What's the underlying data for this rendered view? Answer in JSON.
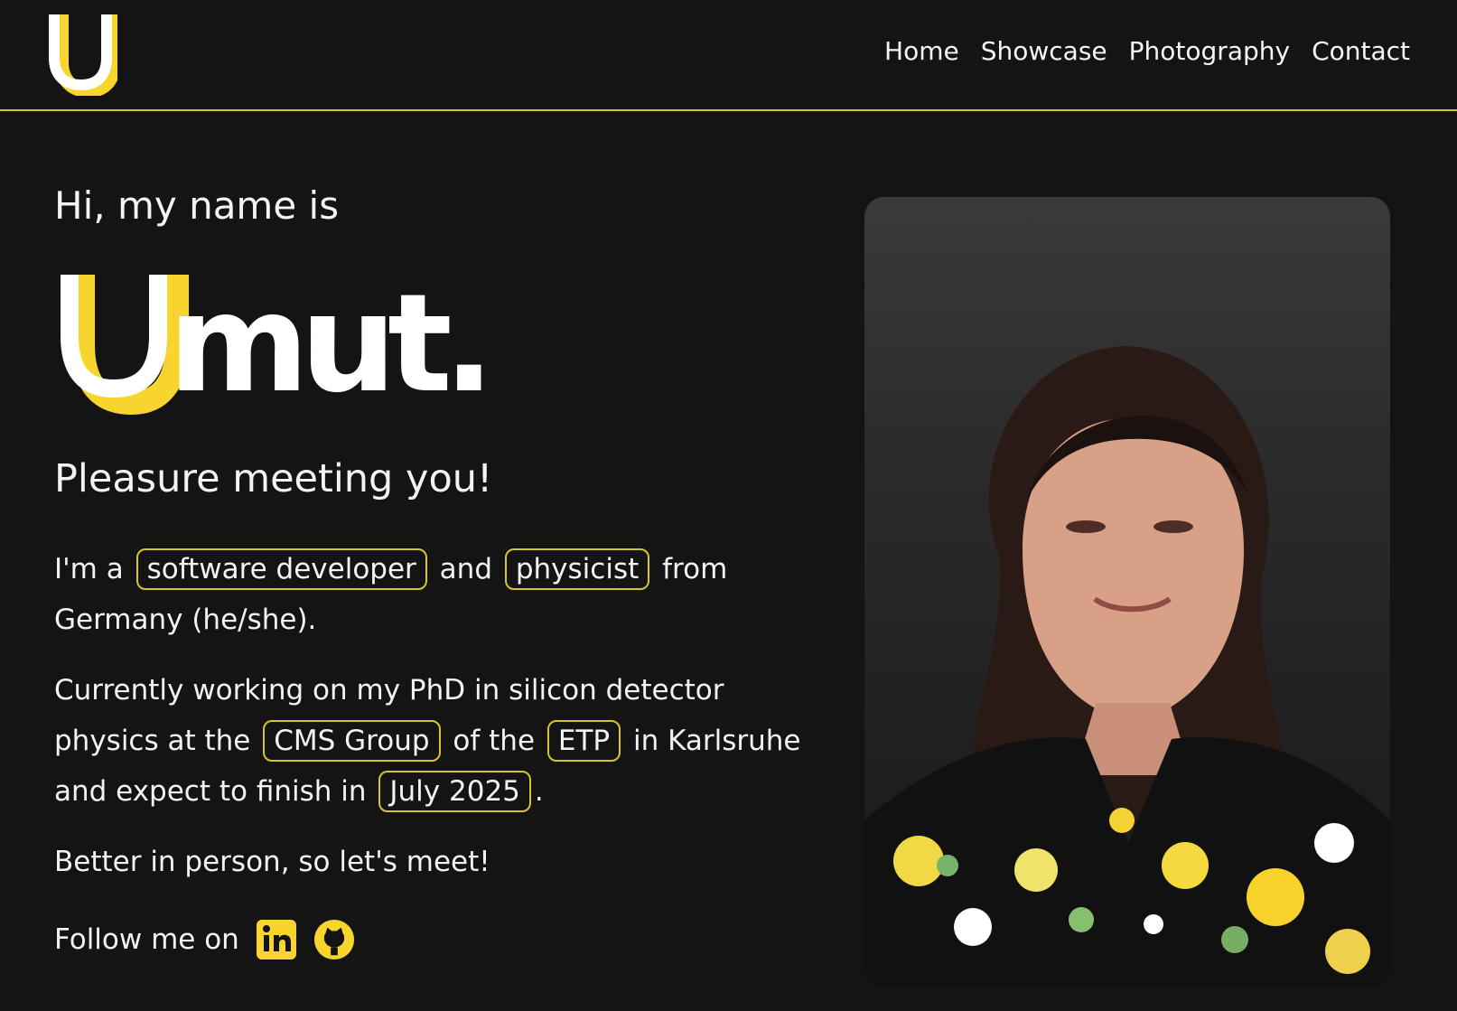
{
  "nav": {
    "items": [
      "Home",
      "Showcase",
      "Photography",
      "Contact"
    ]
  },
  "hero": {
    "greeting": "Hi, my name is",
    "name_main": "mut.",
    "subtitle": "Pleasure meeting you!",
    "intro": {
      "part1": "I'm a",
      "tag1": "software developer",
      "part2": "and",
      "tag2": "physicist",
      "part3": "from Germany (he/she)."
    },
    "phd": {
      "part1": "Currently working on my PhD in silicon detector physics at the",
      "tag1": "CMS Group",
      "part2": "of the",
      "tag2": "ETP",
      "part3": "in Karlsruhe and expect to finish in",
      "tag3": "July 2025",
      "part4": "."
    },
    "meet": "Better in person, so let's meet!",
    "follow": "Follow me on"
  },
  "social": {
    "linkedin_icon": "linkedin-icon",
    "github_icon": "github-icon"
  },
  "colors": {
    "accent": "#f7d52e",
    "background": "#141414",
    "text": "#f3f3f3",
    "tag_border": "#d6c431"
  }
}
